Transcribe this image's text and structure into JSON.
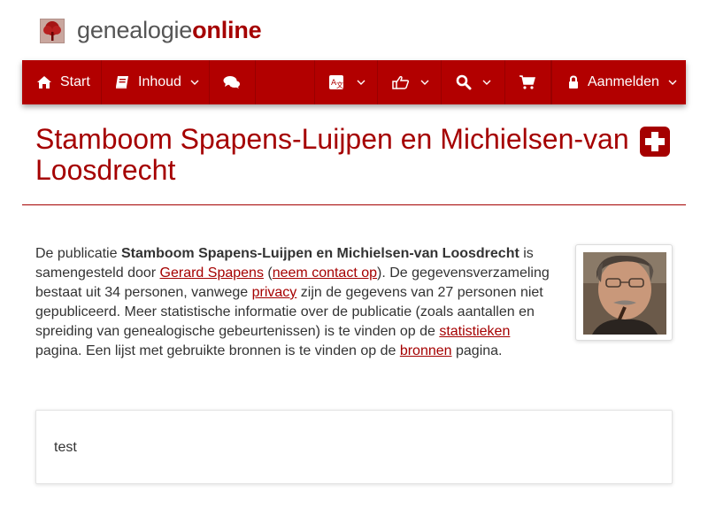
{
  "site": {
    "name_part1": "genealogie",
    "name_part2": "online"
  },
  "nav": {
    "start_label": "Start",
    "inhoud_label": "Inhoud",
    "login_label": "Aanmelden",
    "icons": [
      "home-icon",
      "book-icon",
      "comments-icon",
      "language-icon",
      "thumbs-up-icon",
      "search-icon",
      "shopping-cart-icon",
      "lock-icon"
    ]
  },
  "page": {
    "title": "Stamboom Spapens-Luijpen en Michielsen-van Loosdrecht"
  },
  "intro": {
    "t1": "De publicatie ",
    "pub_name": "Stamboom Spapens-Luijpen en Michielsen-van Loosdrecht",
    "t2": " is samengesteld door ",
    "author_link": "Gerard Spapens",
    "t3": " (",
    "contact_link": "neem contact op",
    "t4": "). De gegevensverzameling bestaat uit 34 personen, vanwege ",
    "privacy_link": "privacy",
    "t5": " zijn de gegevens van 27 personen niet gepubliceerd. Meer statistische informatie over de publicatie (zoals aantallen en spreiding van genealogische gebeurtenissen) is te vinden op de ",
    "stats_link": "statistieken",
    "t6": " pagina. Een lijst met gebruikte bronnen is te vinden op de ",
    "sources_link": "bronnen",
    "t7": " pagina."
  },
  "card": {
    "text": "test"
  },
  "colors": {
    "brand": "#a50000",
    "navbar": "#b20000"
  }
}
